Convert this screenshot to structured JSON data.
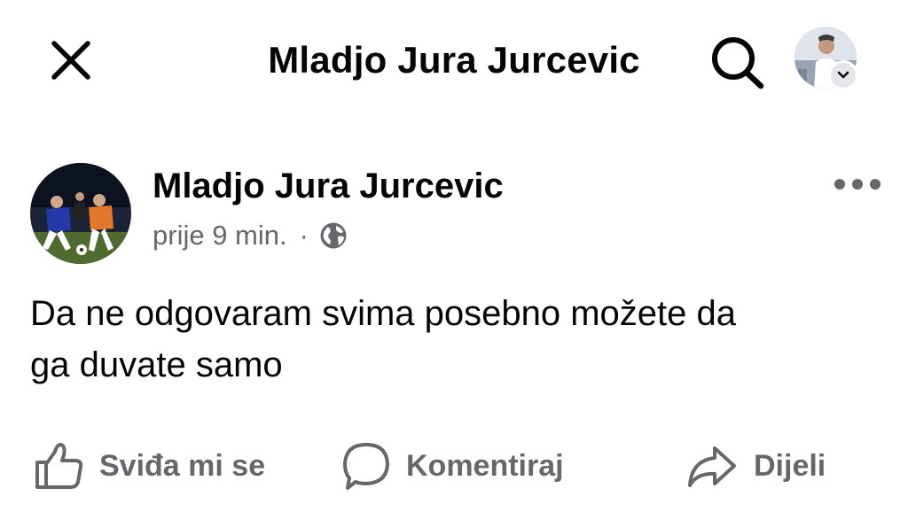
{
  "header": {
    "title": "Mladjo Jura Jurcevic",
    "close_icon": "close-icon",
    "search_icon": "search-icon",
    "profile_icon": "profile-avatar",
    "chevron_icon": "chevron-down-icon"
  },
  "post": {
    "author": "Mladjo Jura Jurcevic",
    "time": "prije 9 min.",
    "separator": "·",
    "audience_icon": "globe-icon",
    "more_icon": "more-options-icon",
    "text_line1": "Da ne odgovaram svima posebno možete da",
    "text_line2": "ga duvate samo"
  },
  "actions": {
    "like": {
      "label": "Sviđa mi se",
      "icon": "thumbs-up-icon"
    },
    "comment": {
      "label": "Komentiraj",
      "icon": "comment-icon"
    },
    "share": {
      "label": "Dijeli",
      "icon": "share-icon"
    }
  },
  "colors": {
    "text_primary": "#050505",
    "text_secondary": "#65676b",
    "background": "#ffffff"
  }
}
